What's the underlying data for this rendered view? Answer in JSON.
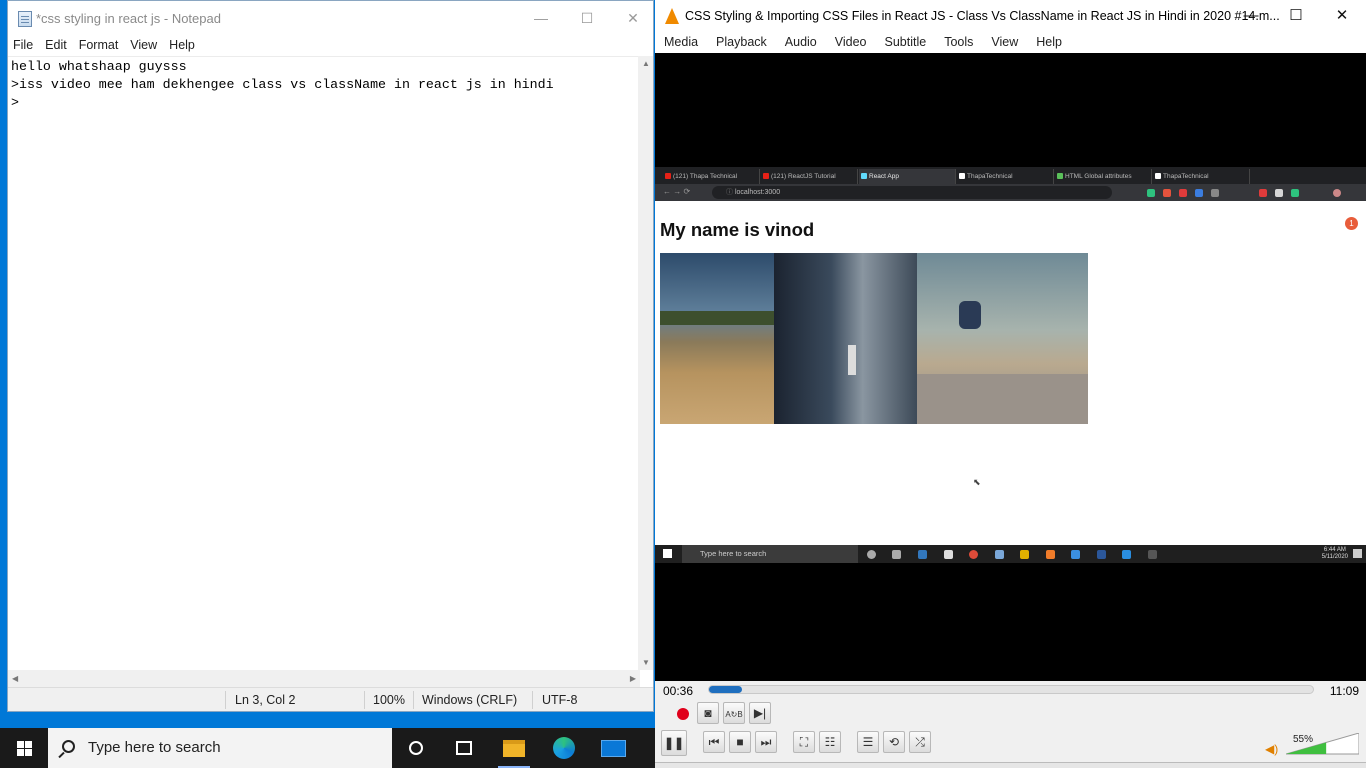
{
  "notepad": {
    "title": "*css styling in react js - Notepad",
    "menu": [
      "File",
      "Edit",
      "Format",
      "View",
      "Help"
    ],
    "lines": [
      "hello whatshaap guysss",
      ">iss video mee ham dekhengee class vs className in react js in hindi",
      ">"
    ],
    "status": {
      "position": "Ln 3, Col 2",
      "zoom": "100%",
      "line_ending": "Windows (CRLF)",
      "encoding": "UTF-8"
    }
  },
  "vlc": {
    "title": "CSS Styling & Importing CSS Files in React JS - Class Vs ClassName in React JS in Hindi in 2020 #14.m...",
    "menu": [
      "Media",
      "Playback",
      "Audio",
      "Video",
      "Subtitle",
      "Tools",
      "View",
      "Help"
    ],
    "time_elapsed": "00:36",
    "time_total": "11:09",
    "progress": 0.054,
    "volume": "55%",
    "volume_level": 0.55,
    "accent": "#1f6fbf"
  },
  "video_browser": {
    "tabs": [
      "(121) Thapa Technical",
      "(121) ReactJS Tutorial",
      "React App",
      "ThapaTechnical",
      "HTML Global attributes",
      "ThapaTechnical"
    ],
    "active_tab": 2,
    "url": "localhost:3000",
    "heading": "My name is vinod",
    "badge": "1"
  },
  "video_taskbar": {
    "search_placeholder": "Type here to search",
    "time": "6:44 AM",
    "date": "5/11/2020"
  },
  "taskbar": {
    "search_placeholder": "Type here to search"
  }
}
